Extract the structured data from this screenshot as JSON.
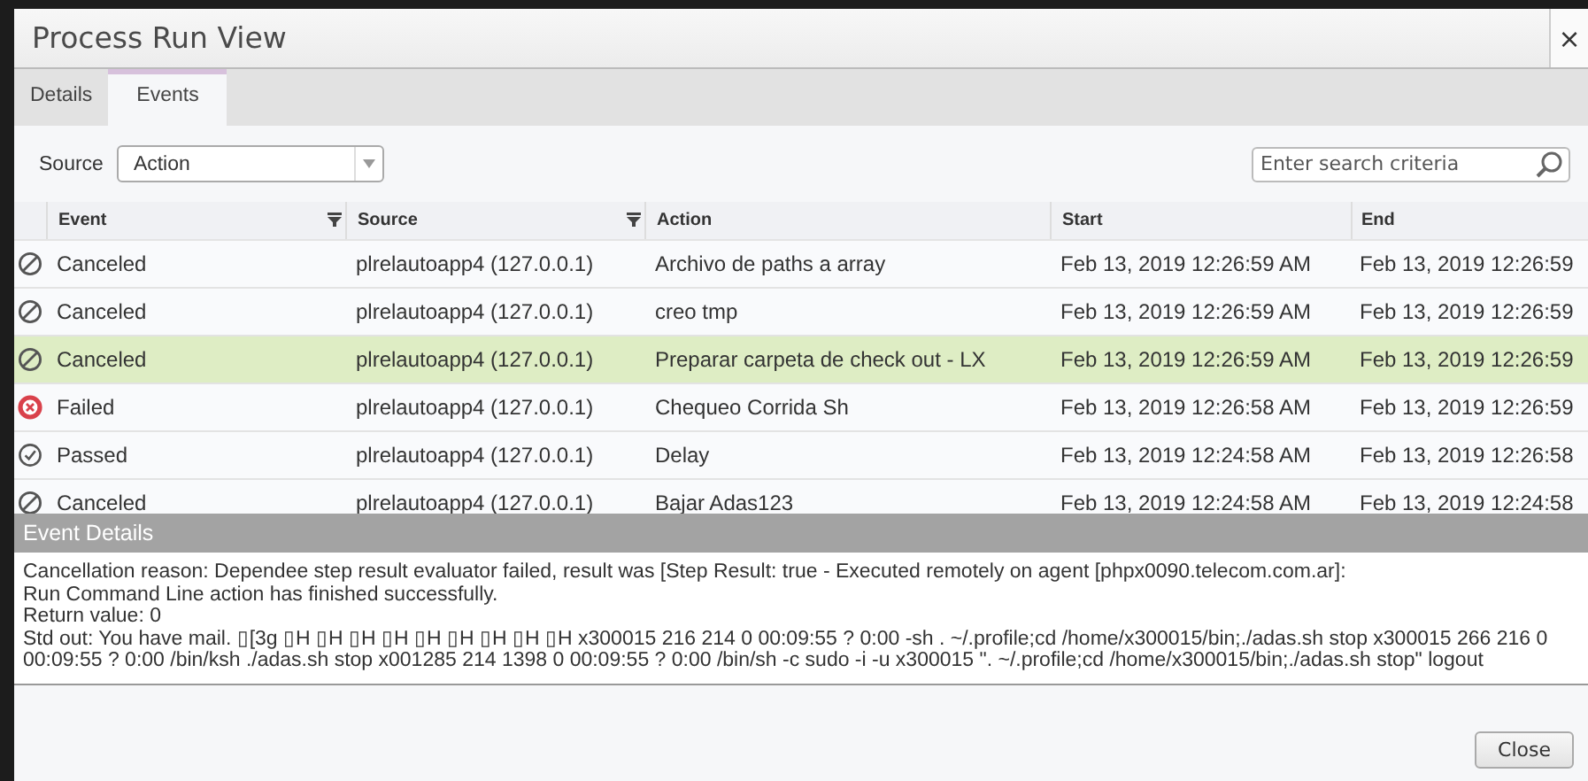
{
  "window": {
    "title": "Process Run View",
    "close": "×"
  },
  "tabs": [
    {
      "label": "Details",
      "selected": false
    },
    {
      "label": "Events",
      "selected": true
    }
  ],
  "toolbar": {
    "source_label": "Source",
    "source_value": "Action",
    "search": {
      "placeholder": "Enter search criteria"
    }
  },
  "table": {
    "columns": [
      {
        "label": "Event",
        "filter": true
      },
      {
        "label": "Source",
        "filter": true
      },
      {
        "label": "Action",
        "filter": false
      },
      {
        "label": "Start",
        "filter": false
      },
      {
        "label": "End",
        "filter": false
      }
    ],
    "rows": [
      {
        "kind": "canceled",
        "selected": false,
        "cells": [
          "Canceled",
          "plrelautoapp4 (127.0.0.1)",
          "Archivo de paths a array",
          "Feb 13, 2019 12:26:59 AM",
          "Feb 13, 2019 12:26:59"
        ]
      },
      {
        "kind": "canceled",
        "selected": false,
        "cells": [
          "Canceled",
          "plrelautoapp4 (127.0.0.1)",
          "creo tmp",
          "Feb 13, 2019 12:26:59 AM",
          "Feb 13, 2019 12:26:59"
        ]
      },
      {
        "kind": "canceled",
        "selected": true,
        "cells": [
          "Canceled",
          "plrelautoapp4 (127.0.0.1)",
          "Preparar carpeta de check out - LX",
          "Feb 13, 2019 12:26:59 AM",
          "Feb 13, 2019 12:26:59"
        ]
      },
      {
        "kind": "failed",
        "selected": false,
        "cells": [
          "Failed",
          "plrelautoapp4 (127.0.0.1)",
          "Chequeo Corrida Sh",
          "Feb 13, 2019 12:26:58 AM",
          "Feb 13, 2019 12:26:59"
        ]
      },
      {
        "kind": "passed",
        "selected": false,
        "cells": [
          "Passed",
          "plrelautoapp4 (127.0.0.1)",
          "Delay",
          "Feb 13, 2019 12:24:58 AM",
          "Feb 13, 2019 12:26:58"
        ]
      },
      {
        "kind": "canceled",
        "selected": false,
        "cells": [
          "Canceled",
          "plrelautoapp4 (127.0.0.1)",
          "Bajar Adas123",
          "Feb 13, 2019 12:24:58 AM",
          "Feb 13, 2019 12:24:58"
        ]
      }
    ]
  },
  "event_details": {
    "title": "Event Details",
    "lines": [
      "Cancellation reason: Dependee step result evaluator failed, result was [Step Result: true - Executed remotely on agent [phpx0090.telecom.com.ar]:",
      "Run Command Line action has finished successfully.",
      "Return value: 0",
      "Std out: You have mail. ▯[3g ▯H ▯H ▯H ▯H ▯H ▯H ▯H ▯H ▯H x300015 216 214 0 00:09:55 ? 0:00 -sh . ~/.profile;cd /home/x300015/bin;./adas.sh stop x300015 266 216 0 00:09:55 ? 0:00 /bin/ksh ./adas.sh stop x001285 214 1398 0 00:09:55 ? 0:00 /bin/sh -c sudo -i -u x300015 \". ~/.profile;cd /home/x300015/bin;./adas.sh stop\" logout"
    ]
  },
  "buttons": [
    {
      "label": "Close"
    }
  ]
}
